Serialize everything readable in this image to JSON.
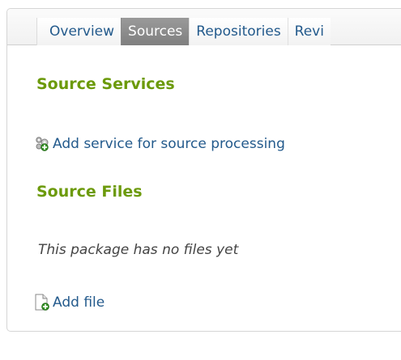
{
  "tabs": [
    {
      "label": "Overview",
      "active": false
    },
    {
      "label": "Sources",
      "active": true
    },
    {
      "label": "Repositories",
      "active": false
    },
    {
      "label": "Revi",
      "active": false
    }
  ],
  "source_services": {
    "heading": "Source Services",
    "add_service_link": "Add service for source processing",
    "add_service_icon": "gears-add-icon"
  },
  "source_files": {
    "heading": "Source Files",
    "empty_message": "This package has no files yet",
    "add_file_link": "Add file",
    "add_file_icon": "file-add-icon"
  },
  "colors": {
    "heading": "#6c9a0b",
    "link": "#235a8c",
    "active_tab_bg": "#8a8a8a"
  }
}
